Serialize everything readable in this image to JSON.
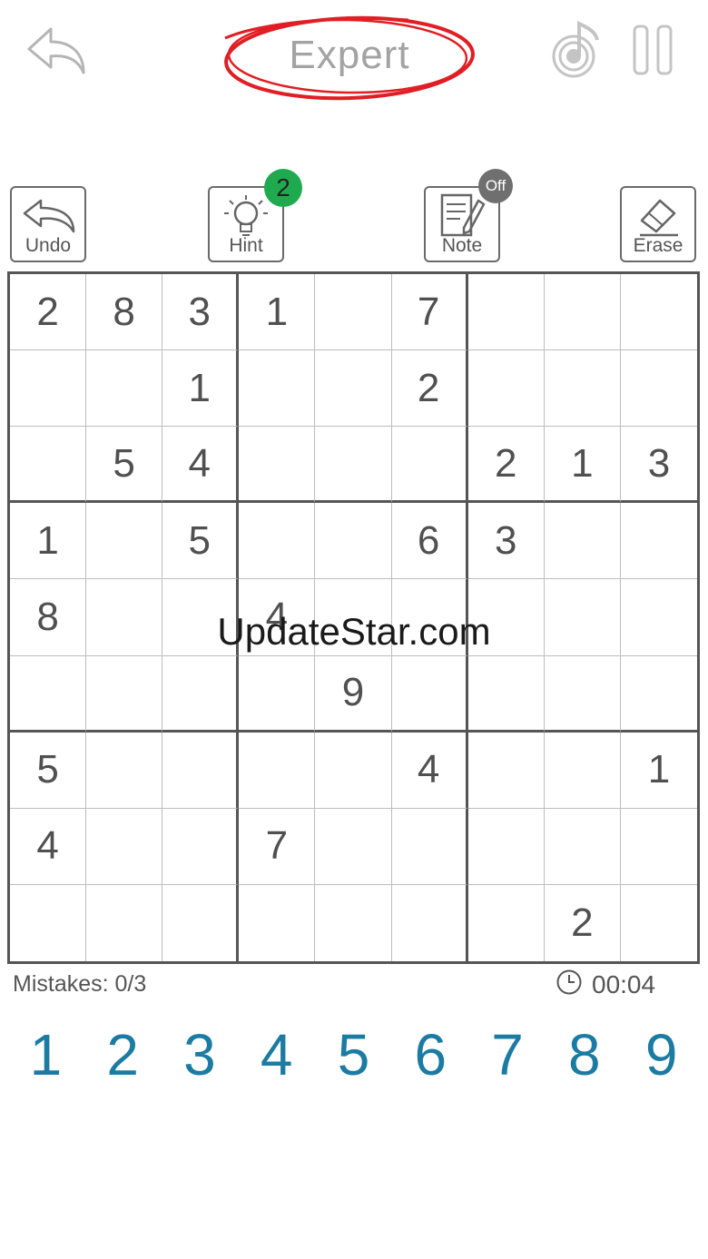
{
  "header": {
    "difficulty": "Expert",
    "back_icon": "back-arrow-icon",
    "music_icon": "music-note-icon",
    "pause_icon": "pause-icon",
    "accent_color": "#e01e24"
  },
  "toolbar": {
    "undo_label": "Undo",
    "hint_label": "Hint",
    "hint_count": "2",
    "note_label": "Note",
    "note_state": "Off",
    "erase_label": "Erase"
  },
  "board": {
    "rows": [
      [
        "2",
        "8",
        "3",
        "1",
        "",
        "7",
        "",
        "",
        ""
      ],
      [
        "",
        "",
        "1",
        "",
        "",
        "2",
        "",
        "",
        ""
      ],
      [
        "",
        "5",
        "4",
        "",
        "",
        "",
        "2",
        "1",
        "3"
      ],
      [
        "1",
        "",
        "5",
        "",
        "",
        "6",
        "3",
        "",
        ""
      ],
      [
        "8",
        "",
        "",
        "4",
        "",
        "",
        "",
        "",
        ""
      ],
      [
        "",
        "",
        "",
        "",
        "9",
        "",
        "",
        "",
        ""
      ],
      [
        "5",
        "",
        "",
        "",
        "",
        "4",
        "",
        "",
        "1"
      ],
      [
        "4",
        "",
        "",
        "7",
        "",
        "",
        "",
        "",
        ""
      ],
      [
        "",
        "",
        "",
        "",
        "",
        "",
        "",
        "2",
        ""
      ]
    ]
  },
  "watermark": "UpdateStar.com",
  "status": {
    "mistakes": "Mistakes: 0/3",
    "timer": "00:04"
  },
  "numpad": [
    "1",
    "2",
    "3",
    "4",
    "5",
    "6",
    "7",
    "8",
    "9"
  ],
  "colors": {
    "numpad": "#1b7ba3",
    "hint_badge": "#1faa50",
    "note_badge": "#6f6f6f"
  }
}
